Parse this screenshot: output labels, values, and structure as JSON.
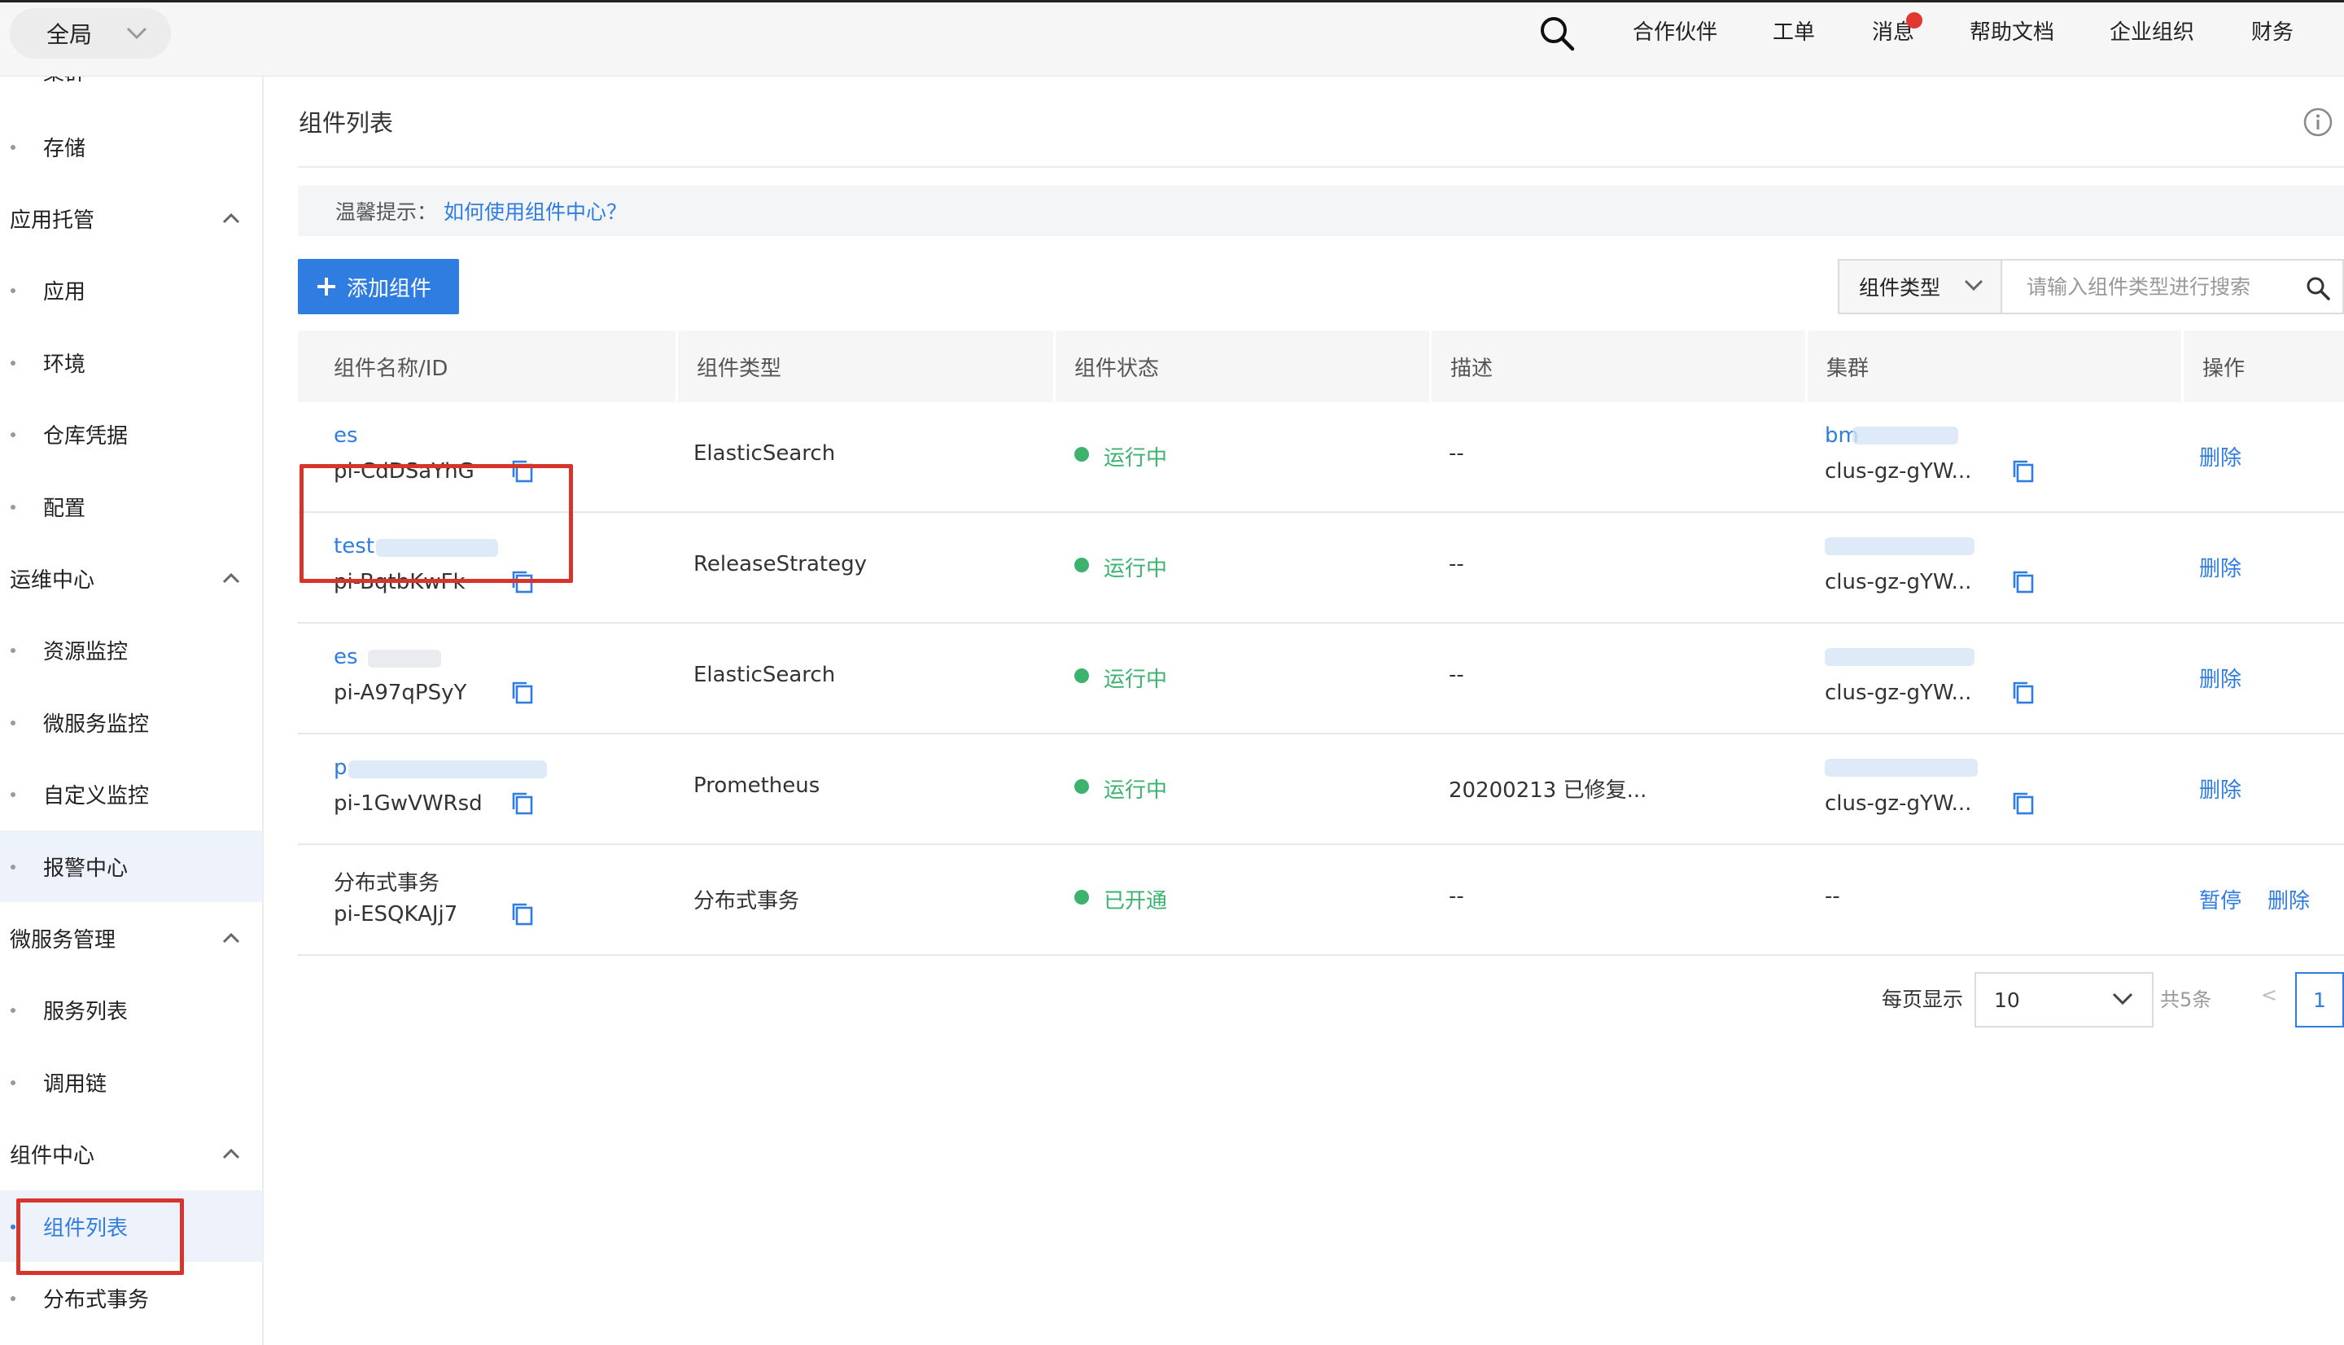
{
  "topbar": {
    "scope_label": "全局",
    "nav_items": [
      "合作伙伴",
      "工单",
      "消息",
      "帮助文档",
      "企业组织",
      "财务"
    ]
  },
  "sidebar": {
    "cut_item": "集群",
    "items": [
      {
        "label": "存储",
        "type": "item"
      },
      {
        "label": "应用托管",
        "type": "group"
      },
      {
        "label": "应用",
        "type": "item"
      },
      {
        "label": "环境",
        "type": "item"
      },
      {
        "label": "仓库凭据",
        "type": "item"
      },
      {
        "label": "配置",
        "type": "item"
      },
      {
        "label": "运维中心",
        "type": "group"
      },
      {
        "label": "资源监控",
        "type": "item"
      },
      {
        "label": "微服务监控",
        "type": "item"
      },
      {
        "label": "自定义监控",
        "type": "item"
      },
      {
        "label": "报警中心",
        "type": "item"
      },
      {
        "label": "微服务管理",
        "type": "group"
      },
      {
        "label": "服务列表",
        "type": "item"
      },
      {
        "label": "调用链",
        "type": "item"
      },
      {
        "label": "组件中心",
        "type": "group"
      },
      {
        "label": "组件列表",
        "type": "item"
      },
      {
        "label": "分布式事务",
        "type": "item"
      }
    ]
  },
  "main": {
    "title": "组件列表",
    "tip_label": "温馨提示：",
    "tip_link": "如何使用组件中心？",
    "add_button": "添加组件",
    "filter_type": "组件类型",
    "search_placeholder": "请输入组件类型进行搜索"
  },
  "table": {
    "columns": [
      "组件名称/ID",
      "组件类型",
      "组件状态",
      "描述",
      "集群",
      "操作"
    ],
    "rows": [
      {
        "name": "es",
        "id": "pi-CdDSaYhG",
        "type": "ElasticSearch",
        "status": "运行中",
        "desc": "--",
        "cluster_name": "bm",
        "cluster_id": "clus-gz-gYW...",
        "actions": [
          "删除"
        ]
      },
      {
        "name": "test",
        "id": "pi-BqtbKwFk",
        "type": "ReleaseStrategy",
        "status": "运行中",
        "desc": "--",
        "cluster_name": "",
        "cluster_id": "clus-gz-gYW...",
        "actions": [
          "删除"
        ]
      },
      {
        "name": "es",
        "id": "pi-A97qPSyY",
        "type": "ElasticSearch",
        "status": "运行中",
        "desc": "--",
        "cluster_name": "",
        "cluster_id": "clus-gz-gYW...",
        "actions": [
          "删除"
        ]
      },
      {
        "name": "p",
        "id": "pi-1GwVWRsd",
        "type": "Prometheus",
        "status": "运行中",
        "desc": "20200213 已修复...",
        "cluster_name": "",
        "cluster_id": "clus-gz-gYW...",
        "actions": [
          "删除"
        ]
      },
      {
        "name": "分布式事务",
        "id": "pi-ESQKAJj7",
        "type": "分布式事务",
        "status": "已开通",
        "desc": "--",
        "cluster_name": "",
        "cluster_id": "--",
        "actions": [
          "暂停",
          "删除"
        ]
      }
    ]
  },
  "pagination": {
    "per_page_label": "每页显示",
    "page_size": "10",
    "total": "共5条",
    "prev": "<",
    "current_page": "1"
  },
  "colors": {
    "accent": "#2f7de1",
    "status_green": "#3bb36e",
    "highlight_red": "#d7352c"
  }
}
